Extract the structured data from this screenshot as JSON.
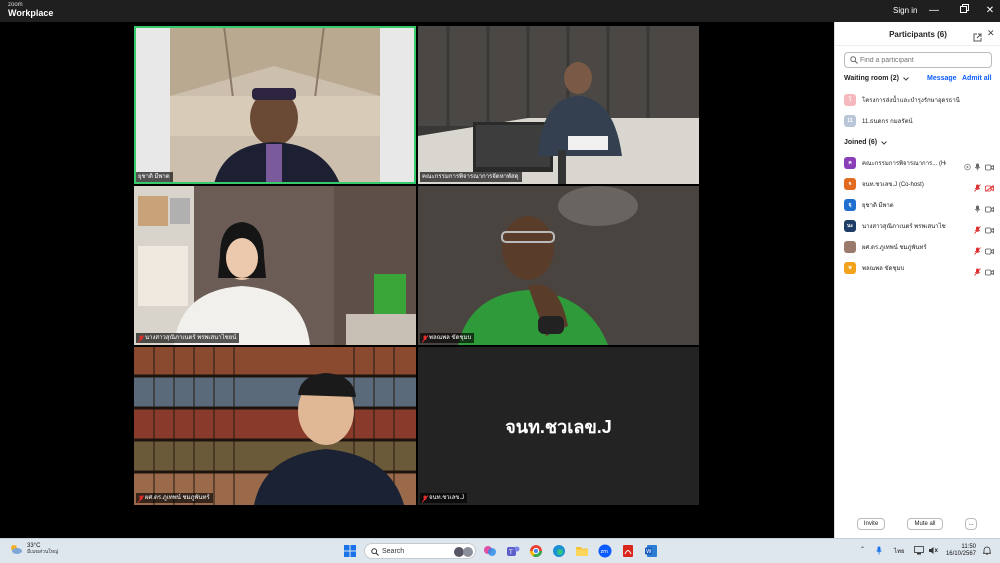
{
  "titlebar": {
    "logo_top": "zoom",
    "logo_bottom": "Workplace",
    "sign_in": "Sign in"
  },
  "video": {
    "tiles": [
      {
        "name": "ยุชาติ มีพาด",
        "active": true
      },
      {
        "name": "คณะกรรมการพิจารณาการจัดหาพัสดุ"
      },
      {
        "name": "นางสาวสุณิภาเนตร์ พรพเสนาไชยน์"
      },
      {
        "name": "พลณพล ขัดชุมบ"
      },
      {
        "name": "ผศ.ดร.ภูเทพน์ ชมภูพันทร์"
      },
      {
        "name": "จนท.ชวเลข.J",
        "center_label": "จนท.ชวเลข.J"
      }
    ]
  },
  "panel": {
    "title": "Participants (6)",
    "search_placeholder": "Find a participant",
    "waiting": {
      "title": "Waiting room (2)",
      "message": "Message",
      "admit_all": "Admit all",
      "items": [
        {
          "initial": "โ",
          "name": "โครงการส่งน้ำและบำรุงรักษาอุดรธานี",
          "color": "#f4b8bd"
        },
        {
          "initial": "11",
          "name": "11.ธนดกร กมลรัตน์",
          "color": "#b9c6d8"
        }
      ]
    },
    "joined": {
      "title": "Joined (6)",
      "items": [
        {
          "initial": "ค",
          "name": "คณะกรรมการพิจารณาการ... (Host, me)",
          "color": "#8a3fb8",
          "mic": "on-gray",
          "video": "on"
        },
        {
          "initial": "จ",
          "name": "จนท.ชวเลข.J (Co-host)",
          "color": "#e26b1f",
          "mic": "muted",
          "video": "off-red"
        },
        {
          "initial": "ยุ",
          "name": "ยุชาติ มีพาด",
          "color": "#1f6fd1",
          "mic": "on",
          "video": "on"
        },
        {
          "initial": "นะ",
          "name": "นางสาวสุณิภาเนตร์ พรพเสนาไชยน์",
          "color": "#1e3d66",
          "mic": "muted",
          "video": "on"
        },
        {
          "initial": "",
          "name": "ผศ.ดร.ภูเทพน์ ชมภูพันทร์",
          "color": "#9a7a6a",
          "mic": "muted",
          "video": "on"
        },
        {
          "initial": "พ",
          "name": "พลณพล ขัดชุมบ",
          "color": "#f2a21b",
          "mic": "muted",
          "video": "on"
        }
      ]
    },
    "invite": "Invite",
    "mute_all": "Mute all",
    "more": "..."
  },
  "taskbar": {
    "temp": "33°C",
    "weather_desc": "มีเมฆส่วนใหญ่",
    "search": "Search",
    "lang": "ไทย",
    "time": "11:50",
    "date": "16/10/2567"
  },
  "colors": {
    "accent": "#0b5cff",
    "active_speaker": "#37c96a",
    "muted": "#e02d2d"
  }
}
